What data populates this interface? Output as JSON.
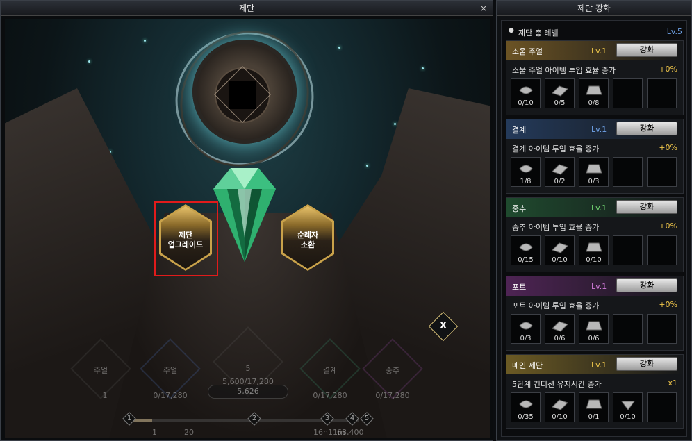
{
  "left_window": {
    "title": "제단",
    "close_label": "×",
    "upgrade_button": "제단\n업그레이드",
    "summon_button": "순례자\n소환",
    "x_button": "X",
    "slots": [
      {
        "label": "주얼",
        "value": "1"
      },
      {
        "label": "주얼",
        "value": "0/17,280"
      },
      {
        "label": "5",
        "value": "5,600/17,280"
      },
      {
        "label": "결계",
        "value": "0/17,280"
      },
      {
        "label": "중추",
        "value": "0/17,280"
      }
    ],
    "center_value": "5,626",
    "markers": [
      "1",
      "2",
      "3",
      "4",
      "5"
    ],
    "bottom_texts": [
      "1",
      "20",
      "16h11m",
      "68,400"
    ]
  },
  "right_window": {
    "title": "제단 강화",
    "total_label": "제단 총 레벨",
    "total_level": "Lv.5",
    "sections": [
      {
        "name": "소울 주얼",
        "level": "Lv.1",
        "button": "강화",
        "desc": "소울 주얼 아이템 투입 효율 증가",
        "pct": "+0%",
        "head_color": "#6b5324",
        "lv_color": "#e8c24a",
        "items": [
          "0/10",
          "0/5",
          "0/8",
          "",
          ""
        ]
      },
      {
        "name": "결계",
        "level": "Lv.1",
        "button": "강화",
        "desc": "결계 아이템 투입 효율 증가",
        "pct": "+0%",
        "head_color": "#243a5a",
        "lv_color": "#6fa3e8",
        "items": [
          "1/8",
          "0/2",
          "0/3",
          "",
          ""
        ]
      },
      {
        "name": "중추",
        "level": "Lv.1",
        "button": "강화",
        "desc": "중추 아이템 투입 효율 증가",
        "pct": "+0%",
        "head_color": "#1f4a2e",
        "lv_color": "#6fd06f",
        "items": [
          "0/15",
          "0/10",
          "0/10",
          "",
          ""
        ]
      },
      {
        "name": "포트",
        "level": "Lv.1",
        "button": "강화",
        "desc": "포트 아이템 투입 효율 증가",
        "pct": "+0%",
        "head_color": "#4e2454",
        "lv_color": "#d07ad8",
        "items": [
          "0/3",
          "0/6",
          "0/6",
          "",
          ""
        ]
      },
      {
        "name": "메인 제단",
        "level": "Lv.1",
        "button": "강화",
        "desc": "5단계 컨디션 유지시간 증가",
        "pct": "x1",
        "head_color": "#6b5a24",
        "lv_color": "#e8c24a",
        "items": [
          "0/35",
          "0/10",
          "0/1",
          "0/10",
          ""
        ]
      }
    ]
  }
}
